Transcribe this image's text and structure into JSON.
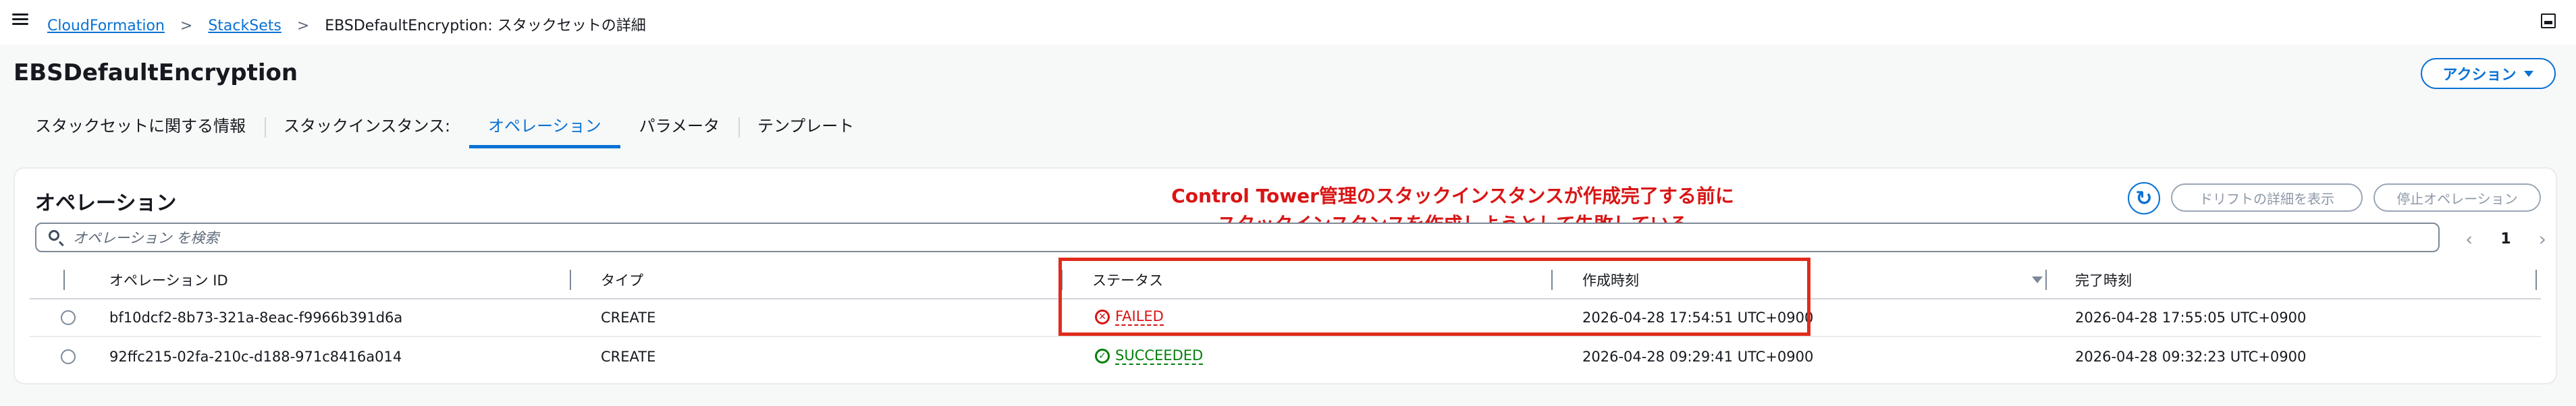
{
  "breadcrumb": {
    "items": [
      "CloudFormation",
      "StackSets"
    ],
    "current": "EBSDefaultEncryption: スタックセットの詳細"
  },
  "page": {
    "title": "EBSDefaultEncryption",
    "actions_label": "アクション"
  },
  "tabs": [
    {
      "label": "スタックセットに関する情報",
      "active": false
    },
    {
      "label": "スタックインスタンス:",
      "active": false
    },
    {
      "label": "オペレーション",
      "active": true
    },
    {
      "label": "パラメータ",
      "active": false
    },
    {
      "label": "テンプレート",
      "active": false
    }
  ],
  "operations": {
    "title": "オペレーション",
    "note_line1": "Control Tower管理のスタックインスタンスが作成完了する前に",
    "note_line2": "スタックインスタンスを作成しようとして失敗している",
    "refresh_icon": "refresh-icon",
    "drift_button": "ドリフトの詳細を表示",
    "stop_button": "停止オペレーション",
    "search_placeholder": "オペレーション を検索",
    "page_number": "1",
    "columns": {
      "id": "オペレーション ID",
      "type": "タイプ",
      "status": "ステータス",
      "created": "作成時刻",
      "completed": "完了時刻"
    },
    "rows": [
      {
        "id": "bf10dcf2-8b73-321a-8eac-f9966b391d6a",
        "type": "CREATE",
        "status": "FAILED",
        "status_icon": "x-circle-icon",
        "created": "2026-04-28 17:54:51 UTC+0900",
        "completed": "2026-04-28 17:55:05 UTC+0900"
      },
      {
        "id": "92ffc215-02fa-210c-d188-971c8416a014",
        "type": "CREATE",
        "status": "SUCCEEDED",
        "status_icon": "check-circle-icon",
        "created": "2026-04-28 09:29:41 UTC+0900",
        "completed": "2026-04-28 09:32:23 UTC+0900"
      }
    ]
  },
  "colors": {
    "link": "#0972d3",
    "error": "#d91515",
    "success": "#037f0c",
    "annotation": "#e02b1c"
  }
}
